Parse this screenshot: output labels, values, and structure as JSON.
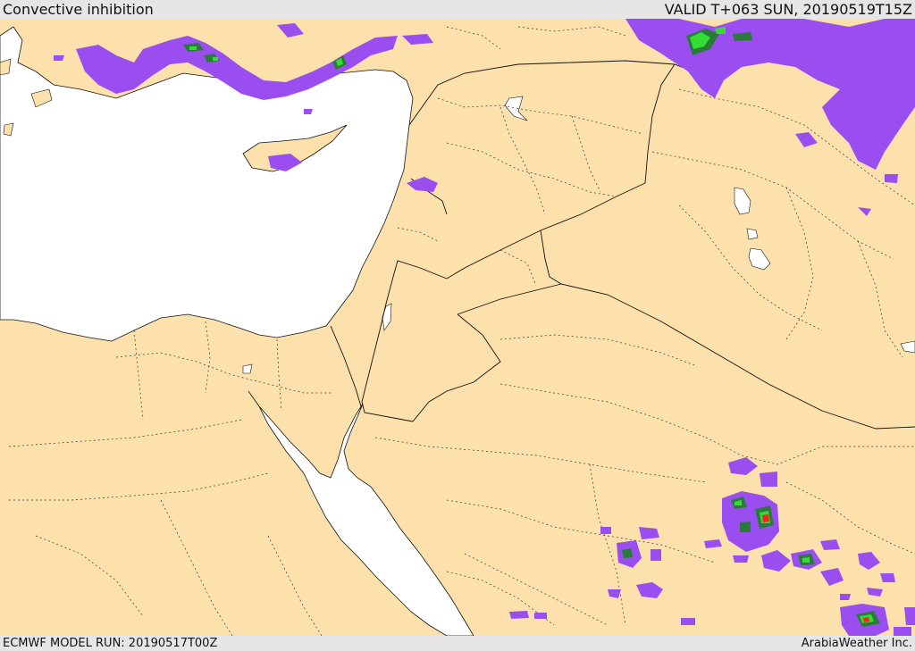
{
  "header": {
    "title": "Convective inhibition",
    "valid": "VALID T+063 SUN, 20190519T15Z"
  },
  "footer": {
    "model_run": "ECMWF MODEL RUN: 20190517T00Z",
    "credit": "ArabiaWeather Inc."
  },
  "colors": {
    "land": "#fde1ad",
    "water": "#ffffff",
    "border": "#111111",
    "level1": "#9a4ef0",
    "level2": "#2a7a3a",
    "level3": "#33dd33",
    "level4": "#ff2020"
  }
}
